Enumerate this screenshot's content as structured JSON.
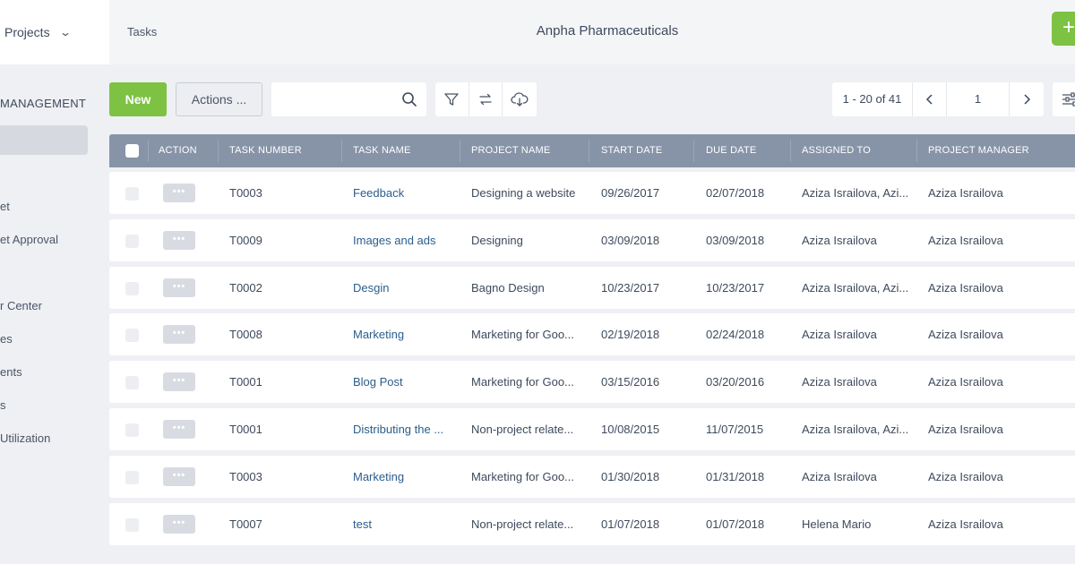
{
  "header": {
    "projects_label": "Projects",
    "breadcrumb": "Tasks",
    "company": "Anpha Pharmaceuticals",
    "add_label": "+"
  },
  "sidebar": {
    "heading": "MANAGEMENT",
    "items": [
      {
        "label": "et"
      },
      {
        "label": "et Approval"
      },
      {
        "label": "r Center"
      },
      {
        "label": "es"
      },
      {
        "label": "ents"
      },
      {
        "label": "s"
      },
      {
        "label": " Utilization"
      }
    ]
  },
  "toolbar": {
    "new_label": "New",
    "actions_label": "Actions ...",
    "search_placeholder": "",
    "search_value": ""
  },
  "pager": {
    "range": "1 - 20 of 41",
    "page": "1"
  },
  "table": {
    "columns": [
      "ACTION",
      "TASK NUMBER",
      "TASK NAME",
      "PROJECT NAME",
      "START DATE",
      "DUE DATE",
      "ASSIGNED TO",
      "PROJECT MANAGER"
    ],
    "action_label": "•••",
    "rows": [
      {
        "number": "T0003",
        "name": "Feedback",
        "project": "Designing a website",
        "start": "09/26/2017",
        "due": "02/07/2018",
        "assigned": "Aziza Israilova, Azi...",
        "manager": "Aziza Israilova"
      },
      {
        "number": "T0009",
        "name": "Images and ads",
        "project": "Designing",
        "start": "03/09/2018",
        "due": "03/09/2018",
        "assigned": "Aziza Israilova",
        "manager": "Aziza Israilova"
      },
      {
        "number": "T0002",
        "name": "Desgin",
        "project": "Bagno Design",
        "start": "10/23/2017",
        "due": "10/23/2017",
        "assigned": "Aziza Israilova, Azi...",
        "manager": "Aziza Israilova"
      },
      {
        "number": "T0008",
        "name": "Marketing",
        "project": "Marketing for Goo...",
        "start": "02/19/2018",
        "due": "02/24/2018",
        "assigned": "Aziza Israilova",
        "manager": "Aziza Israilova"
      },
      {
        "number": "T0001",
        "name": "Blog Post",
        "project": "Marketing for Goo...",
        "start": "03/15/2016",
        "due": "03/20/2016",
        "assigned": "Aziza Israilova",
        "manager": "Aziza Israilova"
      },
      {
        "number": "T0001",
        "name": "Distributing the ...",
        "project": "Non-project relate...",
        "start": "10/08/2015",
        "due": "11/07/2015",
        "assigned": "Aziza Israilova, Azi...",
        "manager": "Aziza Israilova"
      },
      {
        "number": "T0003",
        "name": "Marketing",
        "project": "Marketing for Goo...",
        "start": "01/30/2018",
        "due": "01/31/2018",
        "assigned": "Aziza Israilova",
        "manager": "Aziza Israilova"
      },
      {
        "number": "T0007",
        "name": "test",
        "project": "Non-project relate...",
        "start": "01/07/2018",
        "due": "01/07/2018",
        "assigned": "Helena Mario",
        "manager": "Aziza Israilova"
      }
    ]
  },
  "colors": {
    "accent_green": "#7dc242",
    "header_row": "#8794a8",
    "link": "#2b5d8c"
  }
}
